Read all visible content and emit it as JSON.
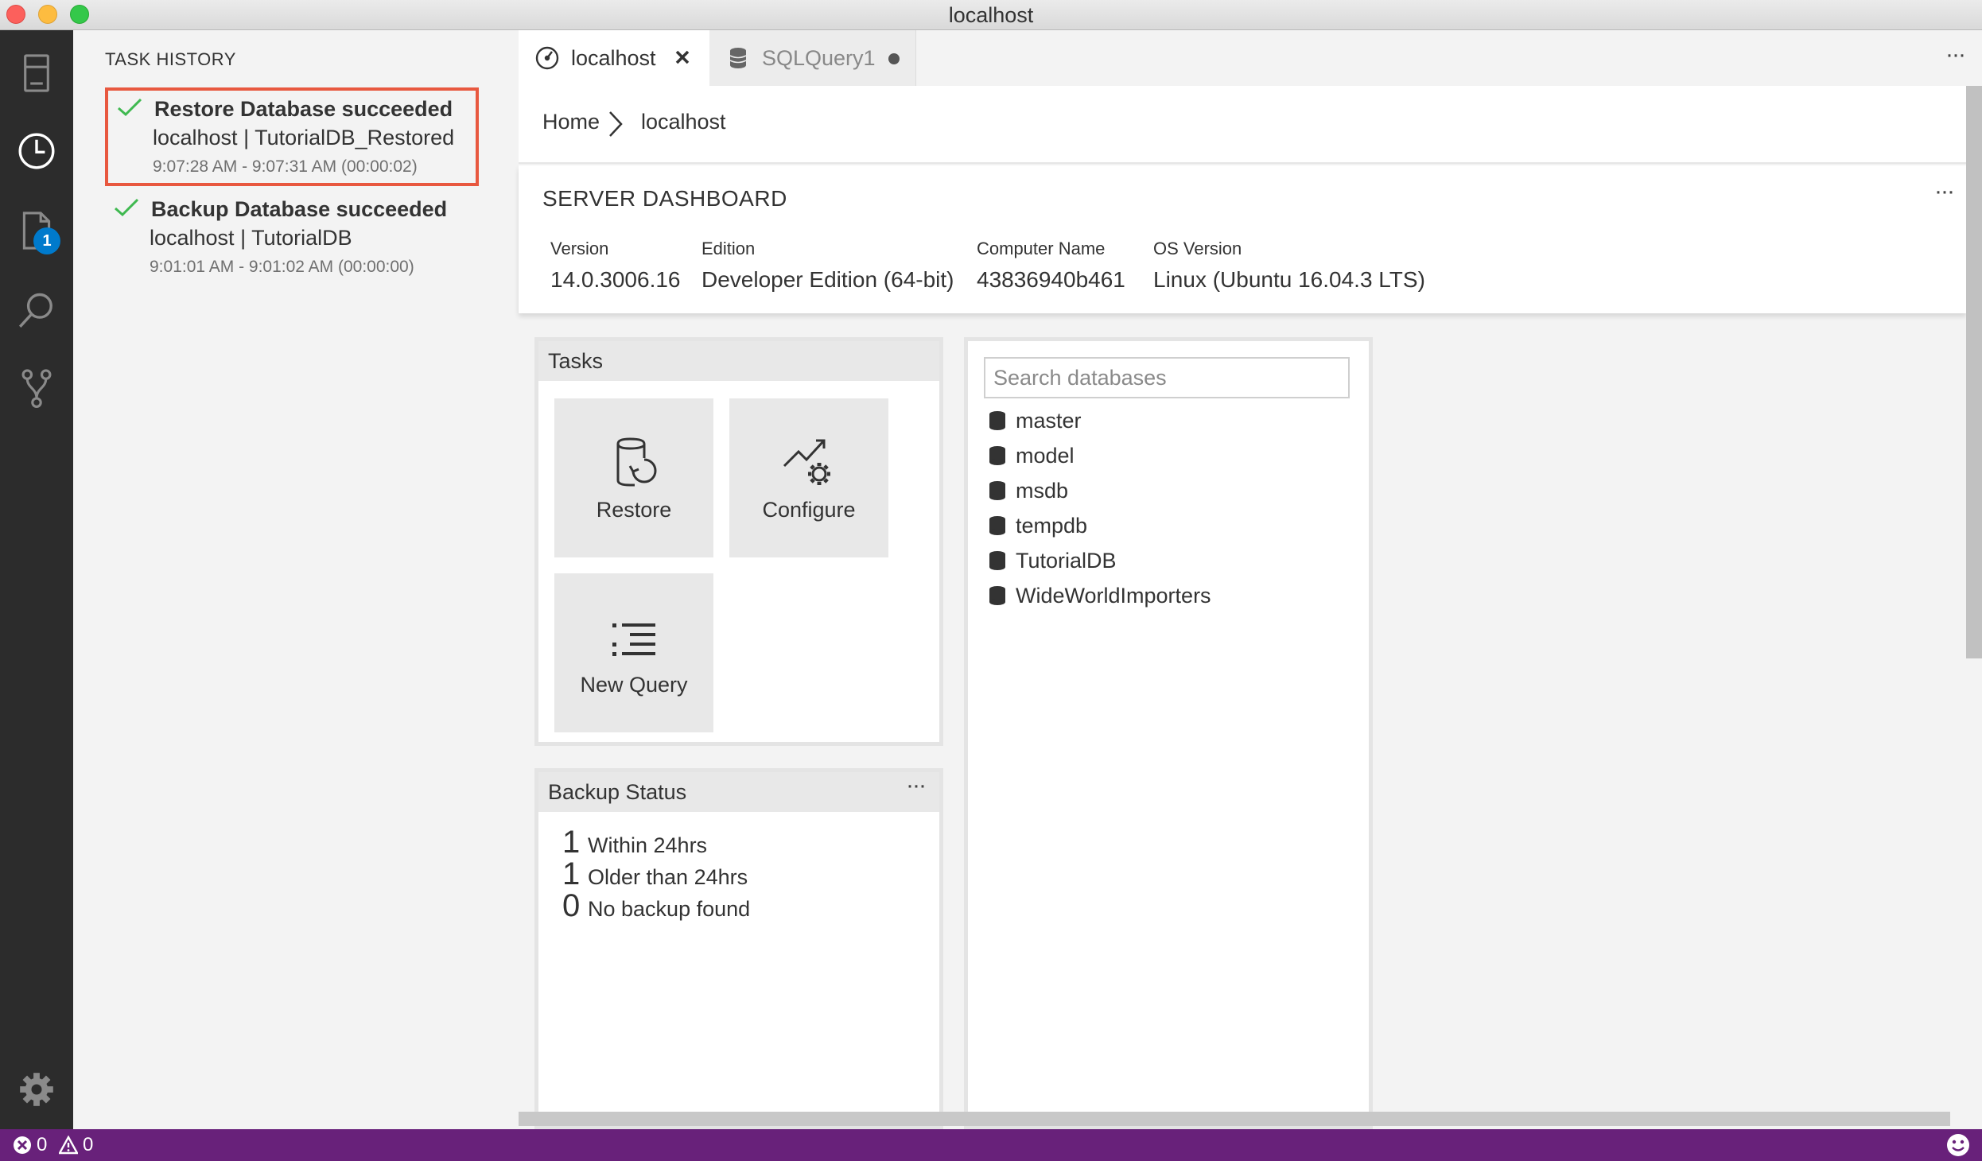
{
  "window": {
    "title": "localhost"
  },
  "activity_bar": {
    "items": [
      {
        "name": "servers",
        "icon": "server-icon"
      },
      {
        "name": "task-history",
        "icon": "clock-icon"
      },
      {
        "name": "explorer",
        "icon": "file-icon",
        "badge": "1"
      },
      {
        "name": "search",
        "icon": "search-icon"
      },
      {
        "name": "source-control",
        "icon": "branch-icon"
      }
    ],
    "settings_icon": "gear-icon"
  },
  "sidebar": {
    "title": "TASK HISTORY",
    "tasks": [
      {
        "title": "Restore Database succeeded",
        "subtitle": "localhost | TutorialDB_Restored",
        "time": "9:07:28 AM - 9:07:31 AM (00:00:02)",
        "status": "success",
        "selected": true
      },
      {
        "title": "Backup Database succeeded",
        "subtitle": "localhost | TutorialDB",
        "time": "9:01:01 AM - 9:01:02 AM (00:00:00)",
        "status": "success",
        "selected": false
      }
    ]
  },
  "tabs": [
    {
      "label": "localhost",
      "icon": "dashboard-icon",
      "active": true,
      "action": "close"
    },
    {
      "label": "SQLQuery1",
      "icon": "database-icon",
      "active": false,
      "dirty": true
    }
  ],
  "tab_more": "···",
  "breadcrumb": {
    "home": "Home",
    "current": "localhost"
  },
  "dashboard": {
    "title": "SERVER DASHBOARD",
    "more": "···",
    "properties": [
      {
        "label": "Version",
        "value": "14.0.3006.16"
      },
      {
        "label": "Edition",
        "value": "Developer Edition (64-bit)"
      },
      {
        "label": "Computer Name",
        "value": "43836940b461"
      },
      {
        "label": "OS Version",
        "value": "Linux (Ubuntu 16.04.3 LTS)"
      }
    ]
  },
  "tasks_widget": {
    "title": "Tasks",
    "items": [
      {
        "label": "Restore",
        "icon": "restore-icon"
      },
      {
        "label": "Configure",
        "icon": "configure-icon"
      },
      {
        "label": "New Query",
        "icon": "new-query-icon"
      }
    ]
  },
  "databases_widget": {
    "search_placeholder": "Search databases",
    "databases": [
      "master",
      "model",
      "msdb",
      "tempdb",
      "TutorialDB",
      "WideWorldImporters"
    ]
  },
  "backup_widget": {
    "title": "Backup Status",
    "more": "···",
    "rows": [
      {
        "count": "1",
        "label": "Within 24hrs"
      },
      {
        "count": "1",
        "label": "Older than 24hrs"
      },
      {
        "count": "0",
        "label": "No backup found"
      }
    ]
  },
  "statusbar": {
    "errors": "0",
    "warnings": "0",
    "feedback_icon": "smiley-icon"
  },
  "colors": {
    "status_bar": "#68217a",
    "activity_bar": "#2c2c2c",
    "badge": "#007acc",
    "selection_border": "#e8583f",
    "success": "#3fb950"
  }
}
